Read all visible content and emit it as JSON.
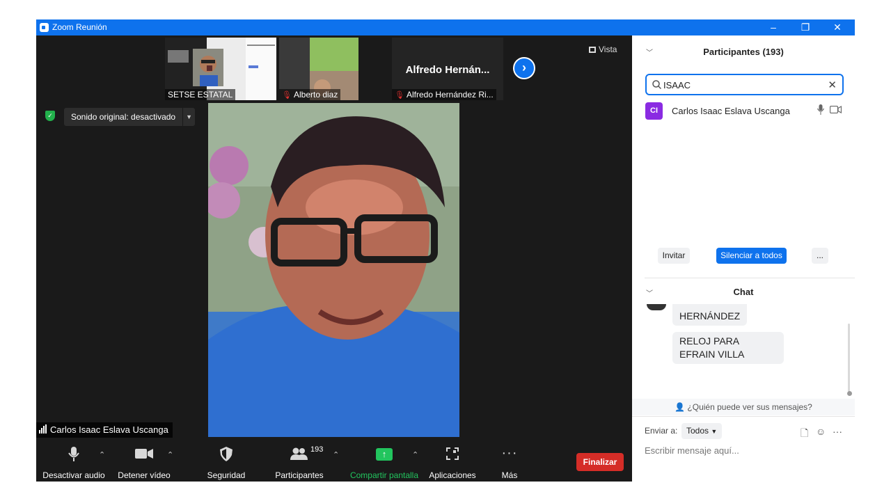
{
  "window": {
    "title": "Zoom Reunión",
    "controls": {
      "minimize": "–",
      "restore": "❐",
      "close": "✕"
    }
  },
  "thumbnails": [
    {
      "label": "SETSE ESTATAL",
      "muted": false
    },
    {
      "label": "Alberto diaz",
      "muted": true
    },
    {
      "label": "Alfredo Hernández Ri...",
      "big_name": "Alfredo  Hernán...",
      "muted": true
    }
  ],
  "view_button": "Vista",
  "original_sound": "Sonido original: desactivado",
  "active_speaker": "Carlos Isaac Eslava Uscanga",
  "toolbar": {
    "mute": "Desactivar audio",
    "video": "Detener vídeo",
    "security": "Seguridad",
    "participants": "Participantes",
    "participants_count": "193",
    "share": "Compartir pantalla",
    "apps": "Aplicaciones",
    "more": "Más",
    "end": "Finalizar"
  },
  "participants_panel": {
    "title": "Participantes (193)",
    "search_value": "ISAAC",
    "results": [
      {
        "initials": "CI",
        "name": "Carlos Isaac Eslava Uscanga",
        "avatar_color": "#8a2be2"
      }
    ],
    "invite": "Invitar",
    "mute_all": "Silenciar a todos",
    "more": "..."
  },
  "chat": {
    "title": "Chat",
    "messages": [
      {
        "text": "HERNÁNDEZ"
      },
      {
        "text": "RELOJ PARA  EFRAIN VILLA"
      }
    ],
    "who_can_see": "¿Quién puede ver sus mensajes?",
    "send_to_label": "Enviar a:",
    "send_to_value": "Todos",
    "placeholder": "Escribir mensaje aquí..."
  },
  "colors": {
    "accent": "#0e72ed",
    "end_button": "#d52d27",
    "share_green": "#22c55e",
    "avatar": "#8a2be2"
  }
}
